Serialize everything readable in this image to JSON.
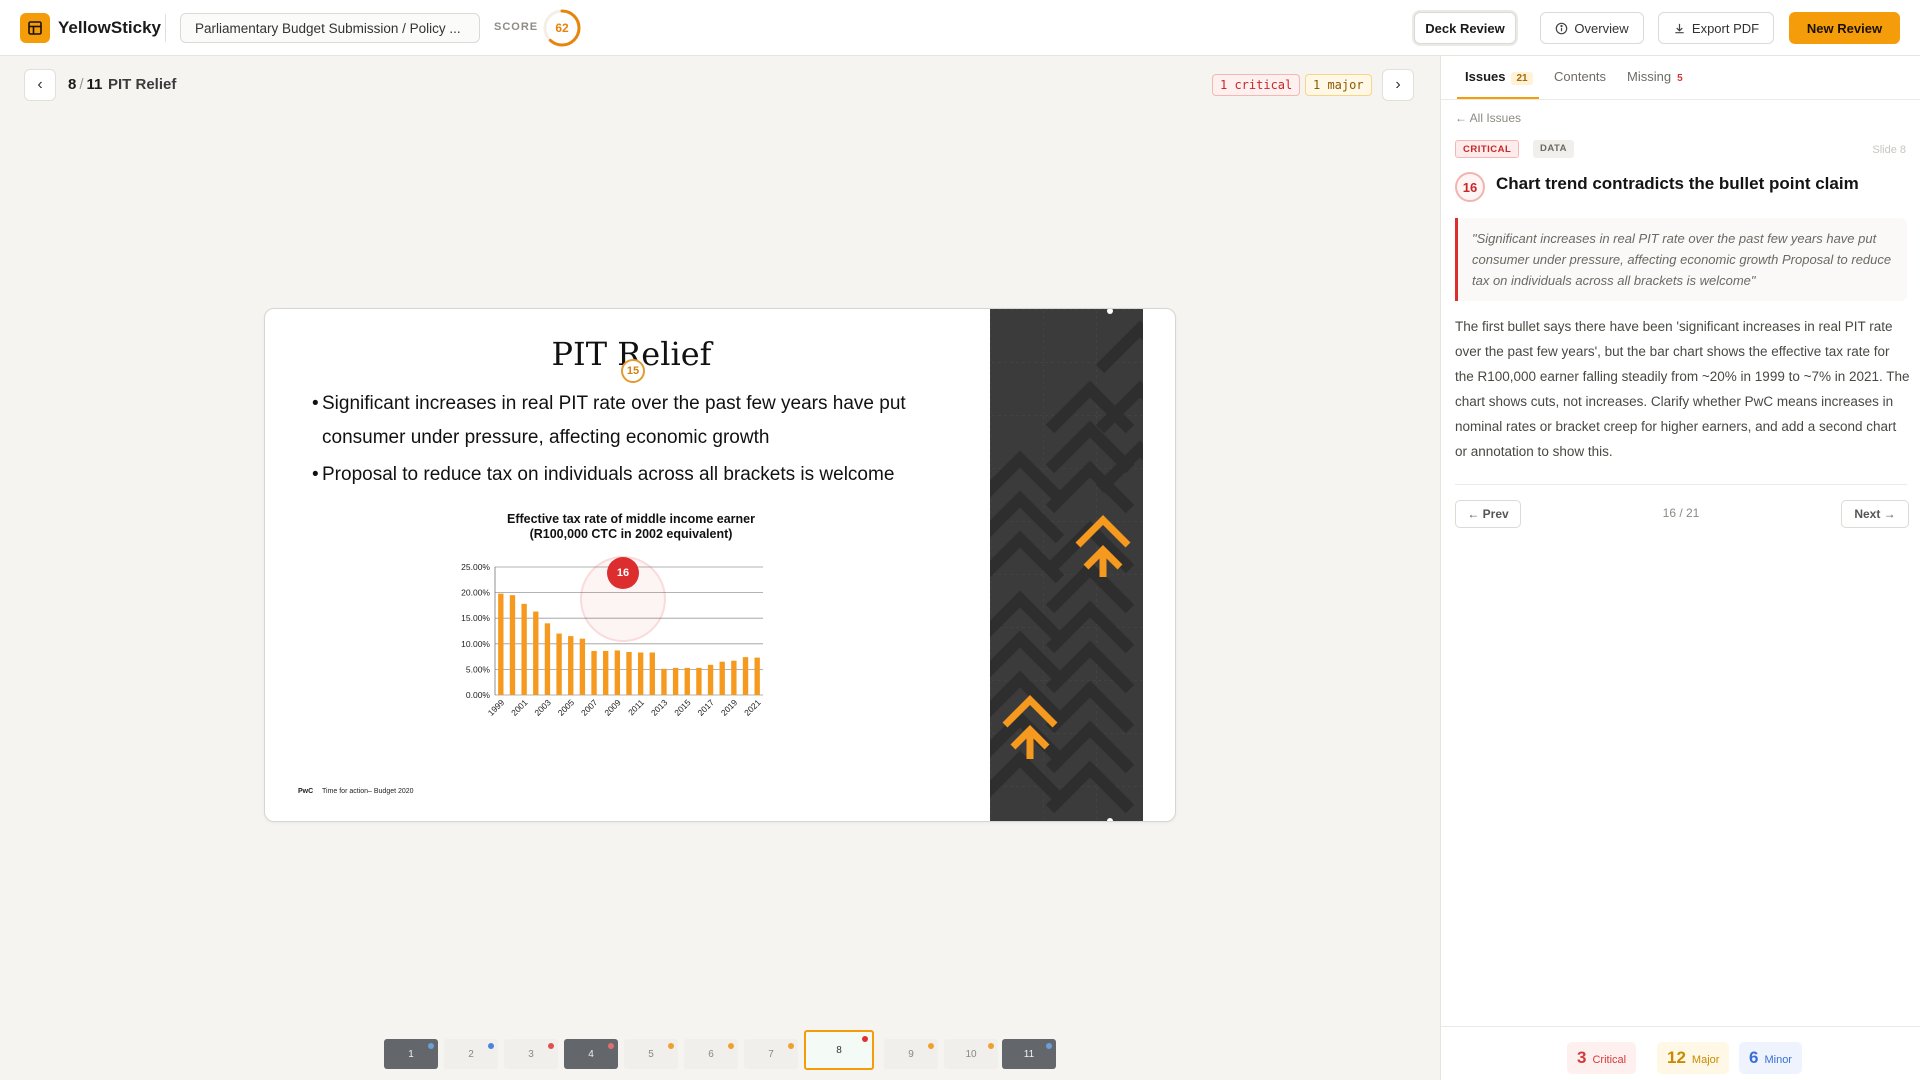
{
  "app": {
    "brand": "YellowSticky",
    "doc_title": "Parliamentary Budget Submission / Policy ...",
    "score_label": "SCORE",
    "score": 62,
    "accent": "#f59c0b"
  },
  "toolbar": {
    "deck_review": "Deck Review",
    "overview": "Overview",
    "export_pdf": "Export PDF",
    "new_review": "New Review"
  },
  "slide_header": {
    "current": "8",
    "separator": "/",
    "total": "11",
    "name": "PIT Relief",
    "critical_tag": "1 critical",
    "major_tag": "1 major"
  },
  "slide": {
    "title": "PIT Relief",
    "bullets": [
      "Significant increases in real PIT rate over the past few years have put consumer under pressure, affecting economic growth",
      "Proposal to reduce tax on individuals across all brackets is welcome"
    ],
    "footer_logo": "PwC",
    "footer_text": "Time for action– Budget 2020",
    "markers": [
      "15",
      "16"
    ]
  },
  "chart_data": {
    "type": "bar",
    "title": "Effective tax rate of middle income earner",
    "subtitle": "(R100,000 CTC in 2002 equivalent)",
    "xlabel": "",
    "ylabel": "",
    "ylim": [
      0,
      25
    ],
    "y_ticks": [
      "25.00%",
      "20.00%",
      "15.00%",
      "10.00%",
      "5.00%",
      "0.00%"
    ],
    "x_tick_labels": [
      "1999",
      "2001",
      "2003",
      "2005",
      "2007",
      "2009",
      "2011",
      "2013",
      "2015",
      "2017",
      "2019",
      "2021"
    ],
    "categories": [
      "1999",
      "2000",
      "2001",
      "2002",
      "2003",
      "2004",
      "2005",
      "2006",
      "2007",
      "2008",
      "2009",
      "2010",
      "2011",
      "2012",
      "2013",
      "2014",
      "2015",
      "2016",
      "2017",
      "2018",
      "2019",
      "2020",
      "2021"
    ],
    "values": [
      19.8,
      19.5,
      17.8,
      16.3,
      14.0,
      12.0,
      11.5,
      11.0,
      8.6,
      8.6,
      8.7,
      8.4,
      8.3,
      8.3,
      5.1,
      5.3,
      5.3,
      5.3,
      5.9,
      6.5,
      6.7,
      7.4,
      7.3
    ],
    "grid": true,
    "bar_color": "#f59a1f"
  },
  "thumbnails": [
    {
      "label": "1",
      "dot": "#6aa0d8"
    },
    {
      "label": "2",
      "dot": "#4a84e0"
    },
    {
      "label": "3",
      "dot": "#e05050"
    },
    {
      "label": "4",
      "dot": "#e07070"
    },
    {
      "label": "5",
      "dot": "#f0a030"
    },
    {
      "label": "6",
      "dot": "#f0a030"
    },
    {
      "label": "7",
      "dot": "#f0a030"
    },
    {
      "label": "8",
      "dot": "#e03030"
    },
    {
      "label": "9",
      "dot": "#f0a030"
    },
    {
      "label": "10",
      "dot": "#f0a030"
    },
    {
      "label": "11",
      "dot": "#6aa0d8"
    }
  ],
  "panel": {
    "tabs": [
      {
        "label": "Issues",
        "count": "21"
      },
      {
        "label": "Contents",
        "count": ""
      },
      {
        "label": "Missing",
        "count": "5"
      }
    ],
    "back_link": "← All Issues",
    "severity": "CRITICAL",
    "category": "DATA",
    "slide_ref": "Slide 8",
    "issue_number": "16",
    "issue_title": "Chart trend contradicts the bullet point claim",
    "quote": "\"Significant increases in real PIT rate over the past few years have put consumer under pressure, affecting economic growth Proposal to reduce tax on individuals across all brackets is welcome\"",
    "description": "The first bullet says there have been 'significant increases in real PIT rate over the past few years', but the bar chart shows the effective tax rate for the R100,000 earner falling steadily from ~20% in 1999 to ~7% in 2021. The chart shows cuts, not increases. Clarify whether PwC means increases in nominal rates or bracket creep for higher earners, and add a second chart or annotation to show this.",
    "prev": "← Prev",
    "next": "Next →",
    "pager": "16  /  21",
    "summary": {
      "critical": {
        "n": "3",
        "label": "Critical"
      },
      "major": {
        "n": "12",
        "label": "Major"
      },
      "minor": {
        "n": "6",
        "label": "Minor"
      }
    }
  }
}
